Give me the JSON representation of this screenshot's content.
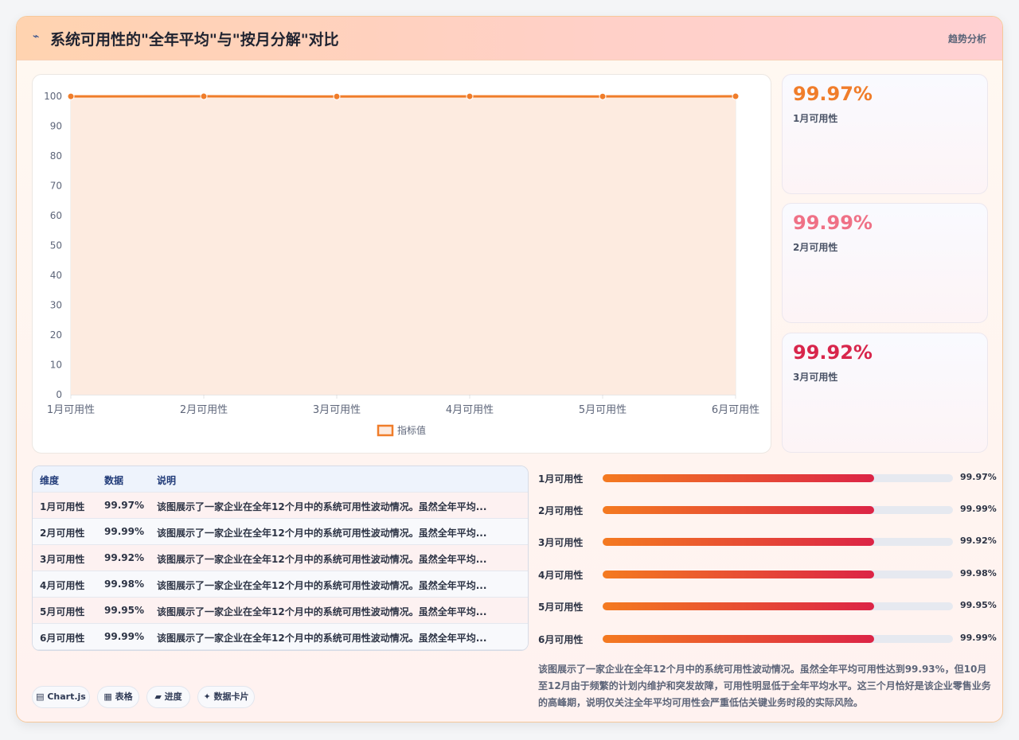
{
  "header": {
    "icon": "bolt-icon",
    "title": "系统可用性的\"全年平均\"与\"按月分解\"对比",
    "tag": "趋势分析"
  },
  "chart_data": {
    "type": "line",
    "categories": [
      "1月可用性",
      "2月可用性",
      "3月可用性",
      "4月可用性",
      "5月可用性",
      "6月可用性"
    ],
    "series": [
      {
        "name": "指标值",
        "values": [
          99.97,
          99.99,
          99.92,
          99.98,
          99.95,
          99.99
        ]
      }
    ],
    "ylim": [
      0,
      100
    ],
    "yticks": [
      "0",
      "10",
      "20",
      "30",
      "40",
      "50",
      "60",
      "70",
      "80",
      "90",
      "100"
    ],
    "filled": true,
    "grid": true,
    "legend": "bottom",
    "color": "#f07d2a",
    "fill_color": "#fdebe0"
  },
  "kpis": [
    {
      "value": "99.97%",
      "label": "1月可用性",
      "color": "#f07d2a"
    },
    {
      "value": "99.99%",
      "label": "2月可用性",
      "color": "#ef7186"
    },
    {
      "value": "99.92%",
      "label": "3月可用性",
      "color": "#d8264c"
    }
  ],
  "table": {
    "headers": [
      "维度",
      "数据",
      "说明"
    ],
    "rows": [
      [
        "1月可用性",
        "99.97%",
        "该图展示了一家企业在全年12个月中的系统可用性波动情况。虽然全年平均..."
      ],
      [
        "2月可用性",
        "99.99%",
        "该图展示了一家企业在全年12个月中的系统可用性波动情况。虽然全年平均..."
      ],
      [
        "3月可用性",
        "99.92%",
        "该图展示了一家企业在全年12个月中的系统可用性波动情况。虽然全年平均..."
      ],
      [
        "4月可用性",
        "99.98%",
        "该图展示了一家企业在全年12个月中的系统可用性波动情况。虽然全年平均..."
      ],
      [
        "5月可用性",
        "99.95%",
        "该图展示了一家企业在全年12个月中的系统可用性波动情况。虽然全年平均..."
      ],
      [
        "6月可用性",
        "99.99%",
        "该图展示了一家企业在全年12个月中的系统可用性波动情况。虽然全年平均..."
      ]
    ]
  },
  "progress": [
    {
      "label": "1月可用性",
      "value": "99.97%",
      "fill": 0.776
    },
    {
      "label": "2月可用性",
      "value": "99.99%",
      "fill": 0.776
    },
    {
      "label": "3月可用性",
      "value": "99.92%",
      "fill": 0.776
    },
    {
      "label": "4月可用性",
      "value": "99.98%",
      "fill": 0.776
    },
    {
      "label": "5月可用性",
      "value": "99.95%",
      "fill": 0.776
    },
    {
      "label": "6月可用性",
      "value": "99.99%",
      "fill": 0.776
    }
  ],
  "buttons": [
    {
      "icon": "chart-icon",
      "label": "▤ Chart.js"
    },
    {
      "icon": "table-icon",
      "label": "▦ 表格"
    },
    {
      "icon": "progress-icon",
      "label": "▰ 进度"
    },
    {
      "icon": "card-icon",
      "label": "✦ 数据卡片"
    }
  ],
  "description": "该图展示了一家企业在全年12个月中的系统可用性波动情况。虽然全年平均可用性达到99.93%，但10月至12月由于频繁的计划内维护和突发故障，可用性明显低于全年平均水平。这三个月恰好是该企业零售业务的高峰期，说明仅关注全年平均可用性会严重低估关键业务时段的实际风险。"
}
